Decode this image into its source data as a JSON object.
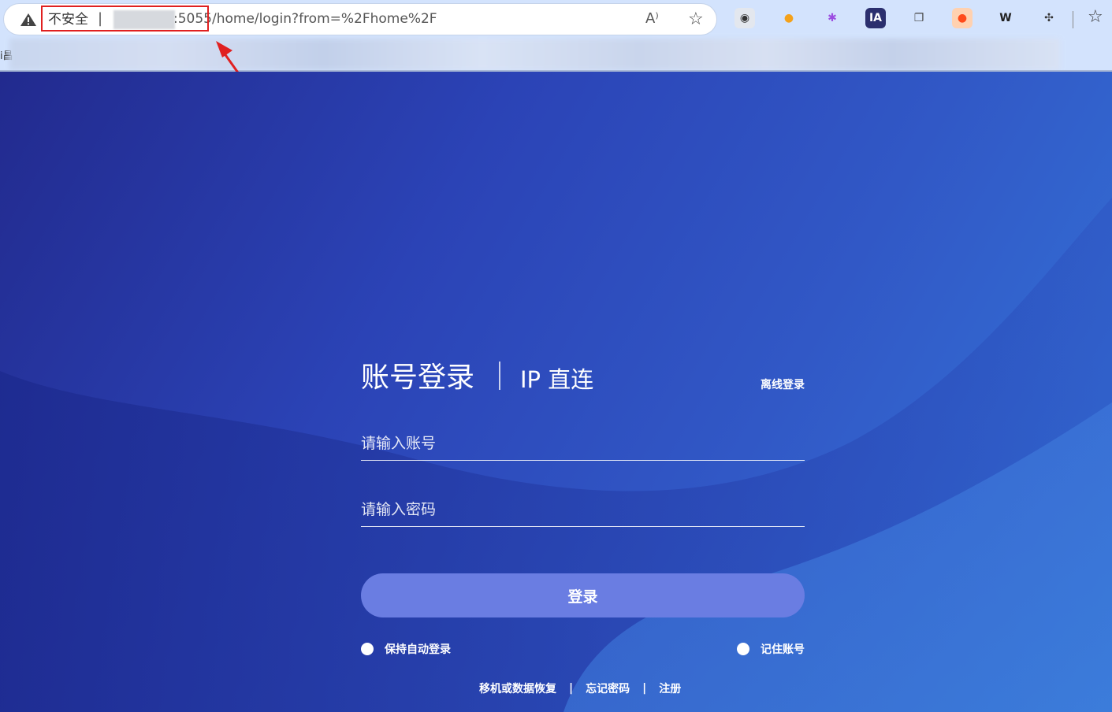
{
  "browser": {
    "security_label": "不安全",
    "separator": "|",
    "url_visible": ":5055/home/login?from=%2Fhome%2F",
    "read_aloud_glyph": "A⁾",
    "favorite_glyph": "☆",
    "favorites_glyph": "☆",
    "extensions": [
      {
        "name": "ghostery-icon",
        "glyph": "◉",
        "bg": "#e3e7ee",
        "fg": "#333"
      },
      {
        "name": "colorful-ext-icon",
        "glyph": "●",
        "bg": "#d3e3fd",
        "fg": "#f4a11a"
      },
      {
        "name": "brain-icon",
        "glyph": "✱",
        "bg": "#d3e3fd",
        "fg": "#9b4de0"
      },
      {
        "name": "ia-icon",
        "glyph": "IA",
        "bg": "#2b2f6e",
        "fg": "#ffffff"
      },
      {
        "name": "copy-icon",
        "glyph": "❐",
        "bg": "#d3e3fd",
        "fg": "#444"
      },
      {
        "name": "orange-ext-icon",
        "glyph": "●",
        "bg": "#ffd1b0",
        "fg": "#ff4a1a"
      },
      {
        "name": "w-icon",
        "glyph": "W",
        "bg": "#d3e3fd",
        "fg": "#222"
      },
      {
        "name": "puzzle-icon",
        "glyph": "✣",
        "bg": "#d3e3fd",
        "fg": "#333"
      }
    ],
    "bookmark_left_text": "i昌"
  },
  "login": {
    "tab_account": "账号登录",
    "tab_ip": "IP 直连",
    "offline_login": "离线登录",
    "account_placeholder": "请输入账号",
    "password_placeholder": "请输入密码",
    "login_button": "登录",
    "keep_logged_in": "保持自动登录",
    "remember_account": "记住账号",
    "links": {
      "recover": "移机或数据恢复",
      "forgot": "忘记密码",
      "register": "注册",
      "separator": "|"
    }
  },
  "colors": {
    "annotation_red": "#e02020",
    "button_bg": "#6a7de2",
    "page_bg_dark": "#222a8e",
    "page_bg_light": "#3577da"
  }
}
